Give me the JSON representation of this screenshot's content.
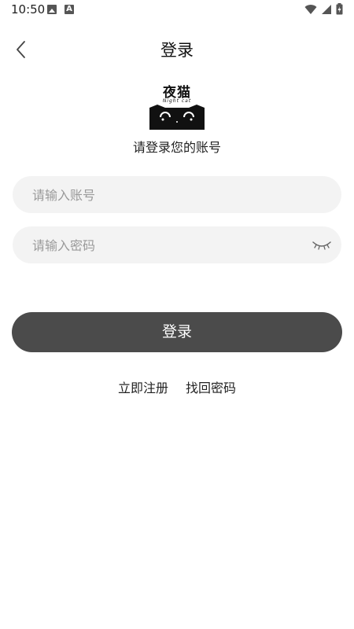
{
  "status_bar": {
    "time": "10:50",
    "left_icons": [
      "image-icon",
      "font-icon"
    ],
    "right_icons": [
      "wifi-icon",
      "signal-icon",
      "battery-icon"
    ]
  },
  "header": {
    "title": "登录",
    "back_icon": "chevron-left-icon"
  },
  "logo": {
    "text": "夜猫",
    "subtext": "Night cat"
  },
  "subtitle": "请登录您的账号",
  "form": {
    "account_placeholder": "请输入账号",
    "account_value": "",
    "password_placeholder": "请输入密码",
    "password_value": "",
    "password_toggle_icon": "eye-closed-icon"
  },
  "login_button_label": "登录",
  "links": {
    "register": "立即注册",
    "forgot_password": "找回密码"
  },
  "colors": {
    "button_bg": "#4b4b4b",
    "input_bg": "#f3f3f3",
    "placeholder": "#9a9a9a"
  }
}
